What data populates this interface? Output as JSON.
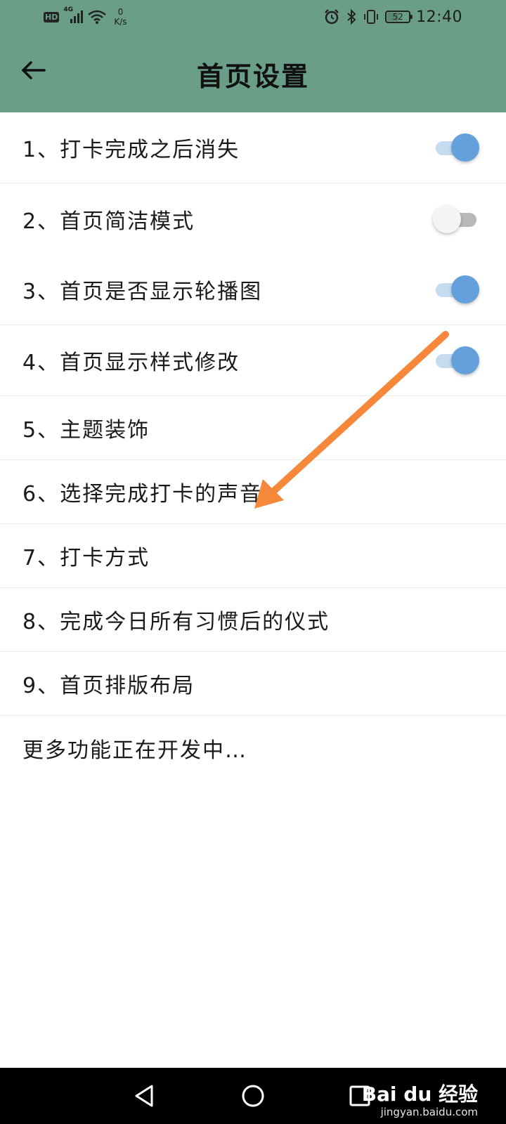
{
  "status_bar": {
    "hd_badge": "HD",
    "network_type": "4G",
    "net_speed_value": "0",
    "net_speed_unit": "K/s",
    "battery_level": "52",
    "battery_fraction": 0.52,
    "time": "12:40",
    "icons": [
      "signal-icon",
      "wifi-icon",
      "alarm-icon",
      "bluetooth-icon",
      "vibrate-icon",
      "battery-icon"
    ]
  },
  "header": {
    "title": "首页设置",
    "back_icon": "arrow-left-icon"
  },
  "settings": {
    "items": [
      {
        "label": "1、打卡完成之后消失",
        "toggle": true
      },
      {
        "label": "2、首页简洁模式",
        "toggle": false
      },
      {
        "label": "3、首页是否显示轮播图",
        "toggle": true
      },
      {
        "label": "4、首页显示样式修改",
        "toggle": true
      },
      {
        "label": "5、主题装饰"
      },
      {
        "label": "6、选择完成打卡的声音"
      },
      {
        "label": "7、打卡方式"
      },
      {
        "label": "8、完成今日所有习惯后的仪式"
      },
      {
        "label": "9、首页排版布局"
      },
      {
        "label": "更多功能正在开发中…"
      }
    ]
  },
  "annotation": {
    "arrow_color": "#f5883a"
  },
  "nav_bar": {
    "buttons": [
      "back-triangle-icon",
      "home-circle-icon",
      "recents-square-icon"
    ]
  },
  "watermark": {
    "brand": "Bai du 经验",
    "domain": "jingyan.baidu.com"
  },
  "colors": {
    "header_bg": "#6a9e88",
    "toggle_on": "#64a0dc",
    "toggle_off": "#f4f4f4"
  }
}
